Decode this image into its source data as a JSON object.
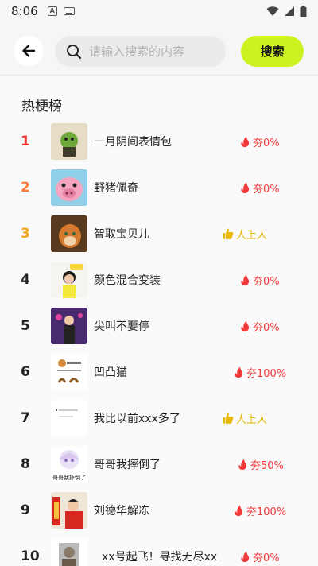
{
  "status_bar": {
    "time": "8:06",
    "icons": [
      "notification-a-icon",
      "keyboard-icon",
      "wifi-icon",
      "signal-icon",
      "battery-icon"
    ]
  },
  "header": {
    "back_icon": "arrow-left-icon",
    "search_placeholder": "请输入搜索的内容",
    "search_button": "搜索"
  },
  "section_title": "热梗榜",
  "colors": {
    "accent": "#ccf21f",
    "rank_red": "#f23a3a",
    "rank_orange": "#ff7b3a",
    "rank_gold": "#f5a623",
    "tag_red": "#f23a3a",
    "tag_gold": "#e6b800"
  },
  "items": [
    {
      "rank": "1",
      "title": "一月阴间表情包",
      "tag": "夯0%",
      "tag_type": "hot"
    },
    {
      "rank": "2",
      "title": "野猪佩奇",
      "tag": "夯0%",
      "tag_type": "hot"
    },
    {
      "rank": "3",
      "title": "智取宝贝儿",
      "tag": "人上人",
      "tag_type": "top"
    },
    {
      "rank": "4",
      "title": "颜色混合变装",
      "tag": "夯0%",
      "tag_type": "hot"
    },
    {
      "rank": "5",
      "title": "尖叫不要停",
      "tag": "夯0%",
      "tag_type": "hot"
    },
    {
      "rank": "6",
      "title": "凹凸猫",
      "tag": "夯100%",
      "tag_type": "hot"
    },
    {
      "rank": "7",
      "title": "我比以前xxx多了",
      "tag": "人上人",
      "tag_type": "top"
    },
    {
      "rank": "8",
      "title": "哥哥我摔倒了",
      "tag": "夯50%",
      "tag_type": "hot",
      "thumb_caption": "哥哥我摔倒了"
    },
    {
      "rank": "9",
      "title": "刘德华解冻",
      "tag": "夯100%",
      "tag_type": "hot"
    },
    {
      "rank": "10",
      "title": "xx号起飞！寻找无尽xx",
      "tag": "夯0%",
      "tag_type": "hot"
    }
  ]
}
